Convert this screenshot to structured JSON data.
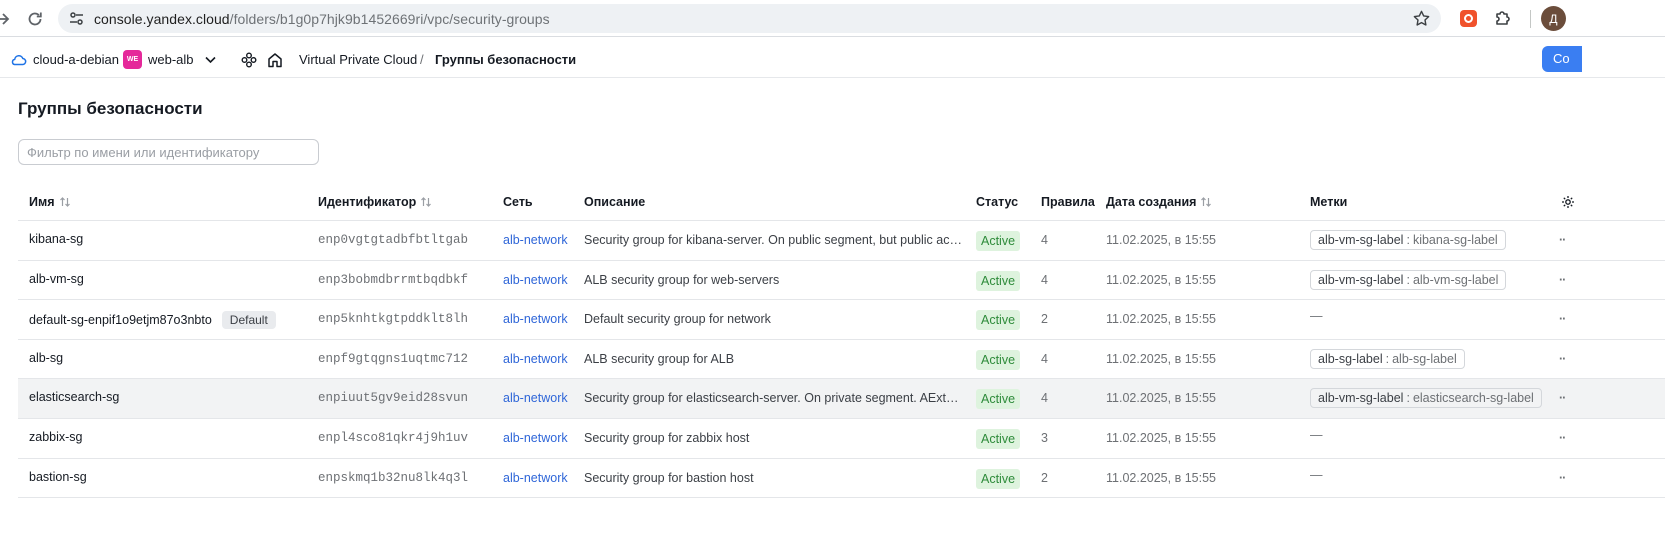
{
  "browser": {
    "url_host": "console.yandex.cloud",
    "url_path": "/folders/b1g0p7hjk9b1452669ri/vpc/security-groups",
    "profile_initial": "Д"
  },
  "header": {
    "cloud_name": "cloud-a-debian",
    "folder_badge": "WE",
    "folder_name": "web-alb",
    "breadcrumb_service": "Virtual Private Cloud",
    "breadcrumb_sep": "/",
    "breadcrumb_current": "Группы безопасности",
    "create_button": "Со"
  },
  "page": {
    "title": "Группы безопасности",
    "filter_placeholder": "Фильтр по имени или идентификатору"
  },
  "table": {
    "columns": {
      "name": "Имя",
      "id": "Идентификатор",
      "network": "Сеть",
      "description": "Описание",
      "status": "Статус",
      "rules": "Правила",
      "created": "Дата создания",
      "labels": "Метки"
    },
    "rows": [
      {
        "name": "kibana-sg",
        "badge": "",
        "id": "enp0vgtgtadbfbtltgab",
        "network": "alb-network",
        "description": "Security group for kibana-server. On public segment, but public acc…",
        "status": "Active",
        "rules": "4",
        "created": "11.02.2025, в 15:55",
        "label_key": "alb-vm-sg-label",
        "label_sep": ":",
        "label_value": "kibana-sg-label",
        "label_empty": ""
      },
      {
        "name": "alb-vm-sg",
        "badge": "",
        "id": "enp3bobmdbrrmtbqdbkf",
        "network": "alb-network",
        "description": "ALB security group for web-servers",
        "status": "Active",
        "rules": "4",
        "created": "11.02.2025, в 15:55",
        "label_key": "alb-vm-sg-label",
        "label_sep": ":",
        "label_value": "alb-vm-sg-label",
        "label_empty": ""
      },
      {
        "name": "default-sg-enpif1o9etjm87o3nbto",
        "badge": "Default",
        "id": "enp5knhtkgtpddklt8lh",
        "network": "alb-network",
        "description": "Default security group for network",
        "status": "Active",
        "rules": "2",
        "created": "11.02.2025, в 15:55",
        "label_key": "",
        "label_sep": "",
        "label_value": "",
        "label_empty": "—"
      },
      {
        "name": "alb-sg",
        "badge": "",
        "id": "enpf9gtqgns1uqtmc712",
        "network": "alb-network",
        "description": "ALB security group for ALB",
        "status": "Active",
        "rules": "4",
        "created": "11.02.2025, в 15:55",
        "label_key": "alb-sg-label",
        "label_sep": ":",
        "label_value": "alb-sg-label",
        "label_empty": ""
      },
      {
        "name": "elasticsearch-sg",
        "badge": "",
        "id": "enpiuut5gv9eid28svun",
        "network": "alb-network",
        "description": "Security group for elasticsearch-server. On private segment. AExter…",
        "status": "Active",
        "rules": "4",
        "created": "11.02.2025, в 15:55",
        "label_key": "alb-vm-sg-label",
        "label_sep": ":",
        "label_value": "elasticsearch-sg-label",
        "label_empty": ""
      },
      {
        "name": "zabbix-sg",
        "badge": "",
        "id": "enpl4sco81qkr4j9h1uv",
        "network": "alb-network",
        "description": "Security group for zabbix host",
        "status": "Active",
        "rules": "3",
        "created": "11.02.2025, в 15:55",
        "label_key": "",
        "label_sep": "",
        "label_value": "",
        "label_empty": "—"
      },
      {
        "name": "bastion-sg",
        "badge": "",
        "id": "enpskmq1b32nu8lk4q3l",
        "network": "alb-network",
        "description": "Security group for bastion host",
        "status": "Active",
        "rules": "2",
        "created": "11.02.2025, в 15:55",
        "label_key": "",
        "label_sep": "",
        "label_value": "",
        "label_empty": "—"
      }
    ],
    "row_actions": "··"
  },
  "colors": {
    "accent": "#3a7ef2",
    "link": "#2f66d8",
    "status_bg": "#def3de",
    "status_text": "#2e8b3a",
    "folder_badge": "#e5289a"
  },
  "icons": [
    "forward-icon",
    "reload-icon",
    "site-info-icon",
    "star-icon",
    "extension-icon",
    "puzzle-icon",
    "cloud-icon",
    "chevron-down-icon",
    "services-icon",
    "home-icon",
    "sort-icon",
    "settings-icon"
  ]
}
